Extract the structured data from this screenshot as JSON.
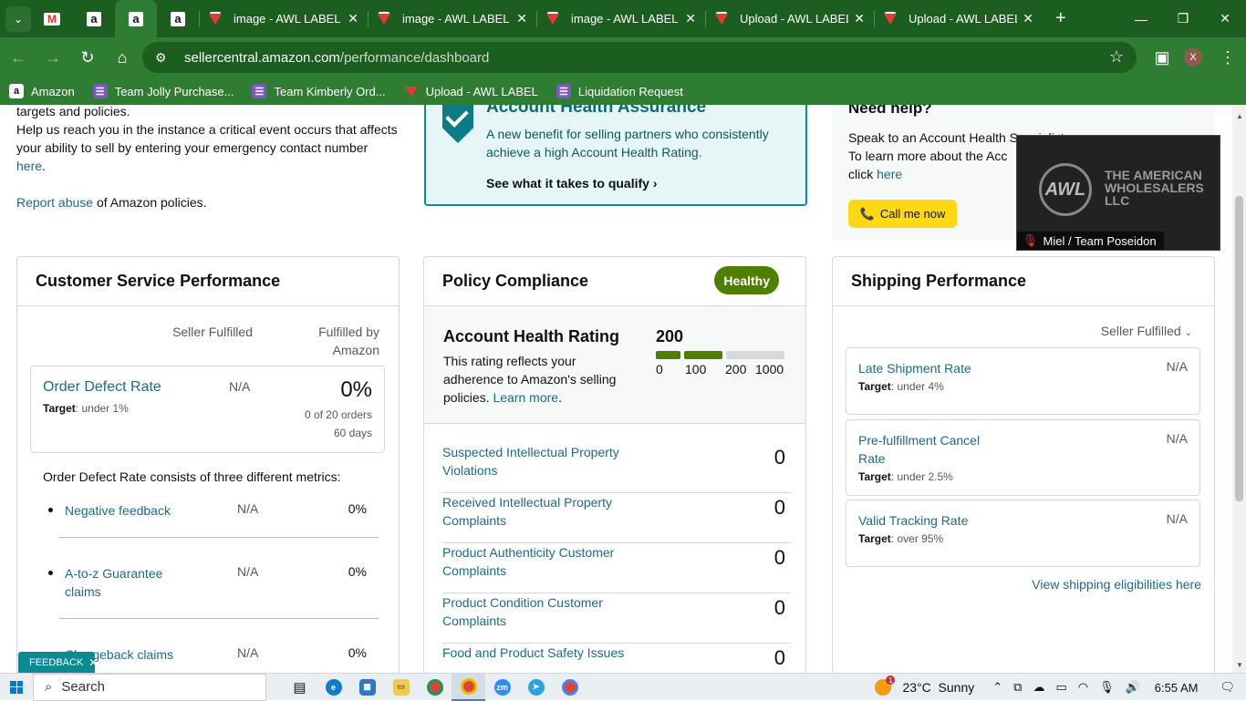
{
  "browser": {
    "tabs": [
      {
        "title": "image - AWL LABEL"
      },
      {
        "title": "image - AWL LABEL"
      },
      {
        "title": "image - AWL LABEL"
      },
      {
        "title": "Upload - AWL LABEL"
      },
      {
        "title": "Upload - AWL LABEL"
      }
    ],
    "url_host": "sellercentral.amazon.com",
    "url_path": "/performance/dashboard",
    "profile_initial": "X",
    "bookmarks": [
      {
        "label": "Amazon",
        "icon": "amazon-icon"
      },
      {
        "label": "Team Jolly Purchase...",
        "icon": "forms-icon"
      },
      {
        "label": "Team Kimberly Ord...",
        "icon": "forms-icon"
      },
      {
        "label": "Upload - AWL LABEL",
        "icon": "awl-icon"
      },
      {
        "label": "Liquidation Request",
        "icon": "forms-icon"
      }
    ]
  },
  "intro": {
    "line1": "targets and policies.",
    "line2": "Help us reach you in the instance a critical event occurs that affects your ability to sell by entering your emergency contact number ",
    "here": "here",
    "line2_end": ".",
    "report_link": "Report abuse",
    "report_rest": " of Amazon policies."
  },
  "aha": {
    "title": "Account Health Assurance",
    "text": "A new benefit for selling partners who consistently achieve a high Account Health Rating.",
    "cta": "See what it takes to qualify"
  },
  "help": {
    "title": "Need help?",
    "line1": "Speak to an Account Health Specialist",
    "line2": "To learn more about the Acc",
    "line3": "click ",
    "here": "here",
    "call": "Call me now"
  },
  "video": {
    "logo_text": "AWL",
    "brand": "THE AMERICAN WHOLESALERS LLC",
    "name": "Miel / Team Poseidon"
  },
  "csp": {
    "title": "Customer Service Performance",
    "col1": "Seller Fulfilled",
    "col2a": "Fulfilled by",
    "col2b": "Amazon",
    "odr_title": "Order Defect Rate",
    "odr_target_label": "Target",
    "odr_target": ": under 1%",
    "odr_sf": "N/A",
    "odr_fba": "0%",
    "odr_orders": "0 of 20 orders",
    "odr_days": "60 days",
    "consists": "Order Defect Rate consists of three different metrics:",
    "metrics": [
      {
        "name": "Negative feedback",
        "sf": "N/A",
        "fba": "0%"
      },
      {
        "name": "A-to-z Guarantee claims",
        "sf": "N/A",
        "fba": "0%"
      },
      {
        "name": "Chargeback claims",
        "sf": "N/A",
        "fba": "0%"
      }
    ]
  },
  "policy": {
    "title": "Policy Compliance",
    "badge": "Healthy",
    "ahr_title": "Account Health Rating",
    "ahr_value": "200",
    "ahr_text": "This rating reflects your adherence to Amazon's selling policies. ",
    "learn": "Learn more",
    "learn_end": ".",
    "scale": [
      "0",
      "100",
      "200",
      "1000"
    ],
    "rows": [
      {
        "label": "Suspected Intellectual Property Violations",
        "value": "0"
      },
      {
        "label": "Received Intellectual Property Complaints",
        "value": "0"
      },
      {
        "label": "Product Authenticity Customer Complaints",
        "value": "0"
      },
      {
        "label": "Product Condition Customer Complaints",
        "value": "0"
      },
      {
        "label": "Food and Product Safety Issues",
        "value": "0"
      }
    ]
  },
  "shipping": {
    "title": "Shipping Performance",
    "dropdown": "Seller Fulfilled",
    "target_label": "Target",
    "rows": [
      {
        "label": "Late Shipment Rate",
        "value": "N/A",
        "target": ": under 4%"
      },
      {
        "label": "Pre-fulfillment Cancel Rate",
        "value": "N/A",
        "target": ": under 2.5%"
      },
      {
        "label": "Valid Tracking Rate",
        "value": "N/A",
        "target": ": over 95%"
      }
    ],
    "link": "View shipping eligibilities here"
  },
  "feedback": "FEEDBACK",
  "taskbar": {
    "search": "Search",
    "weather": "23°C  Sunny",
    "weather_badge": "1",
    "time": "6:55 AM"
  }
}
